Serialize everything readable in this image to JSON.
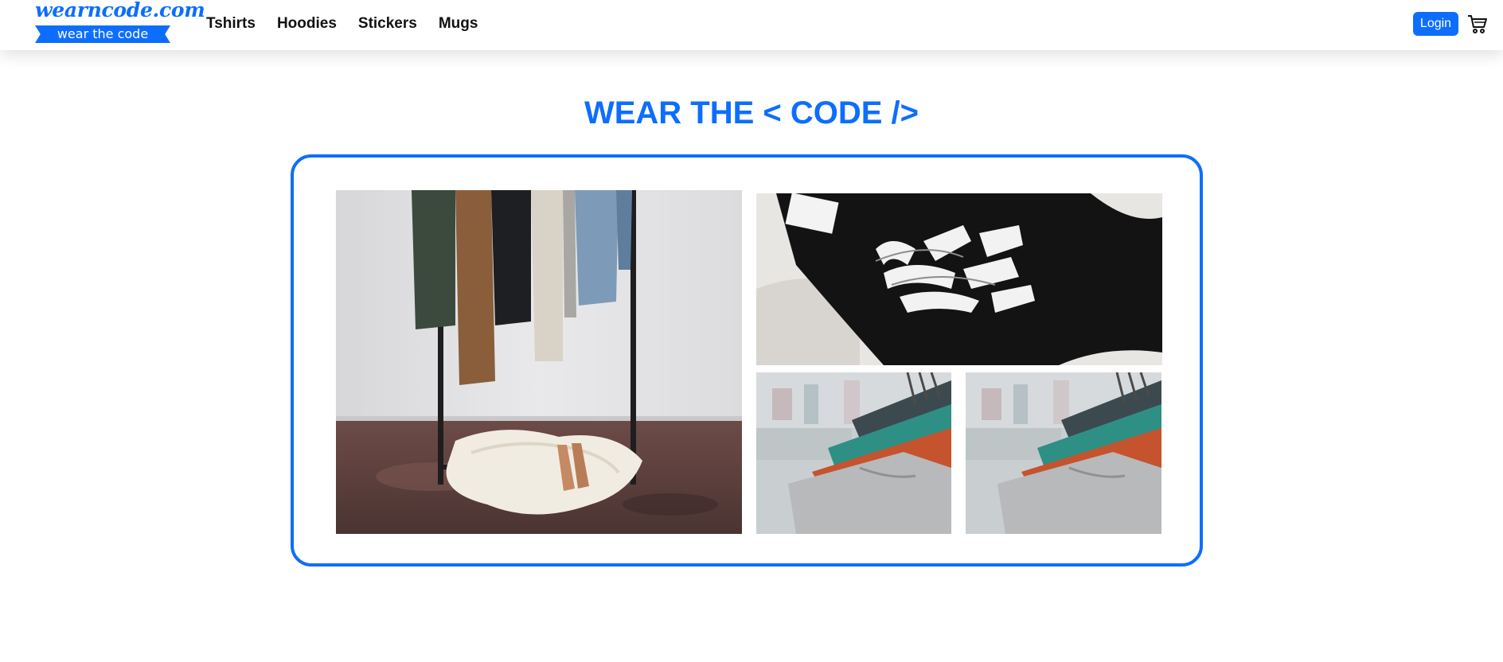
{
  "navbar": {
    "brand": {
      "name": "wearncode.com",
      "tagline": "wear the code"
    },
    "links": [
      "Tshirts",
      "Hoodies",
      "Stickers",
      "Mugs"
    ],
    "login_label": "Login",
    "cart_icon": "shopping-cart-icon"
  },
  "hero": {
    "title": "WEAR THE < CODE />"
  },
  "gallery": {
    "images": [
      "clothing-rack-photo",
      "black-graphic-tshirt-photo",
      "hanging-tshirts-photo",
      "hanging-tshirts-photo"
    ]
  },
  "colors": {
    "accent": "#0d6efd",
    "text": "#111111",
    "background": "#ffffff"
  }
}
